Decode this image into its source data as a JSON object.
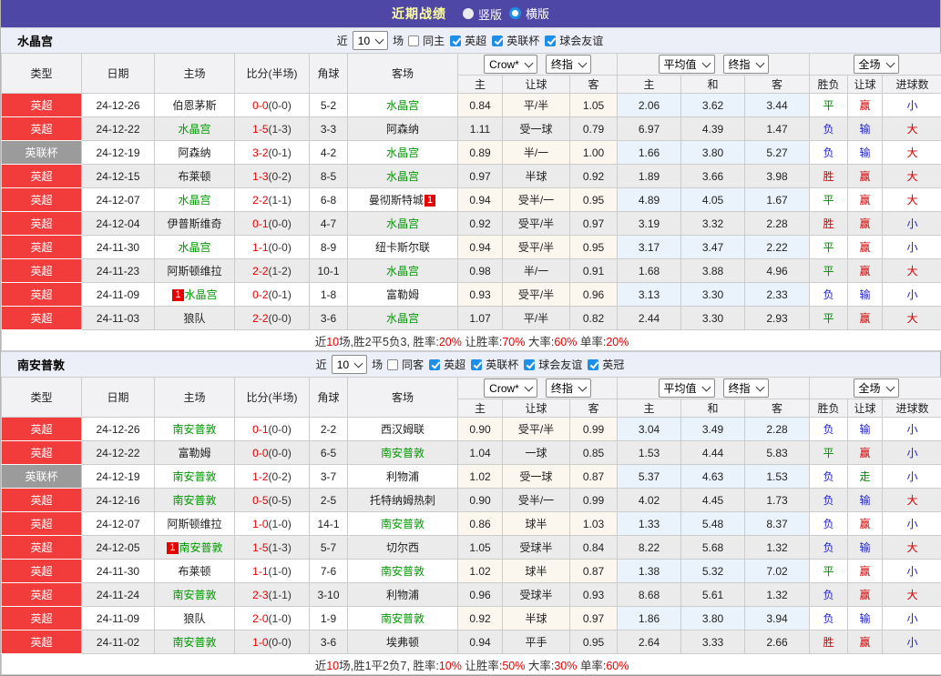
{
  "title_bar": {
    "title": "近期战绩",
    "layout_options": [
      {
        "label": "竖版",
        "selected": false
      },
      {
        "label": "横版",
        "selected": true
      }
    ]
  },
  "columns": {
    "type": "类型",
    "date": "日期",
    "home": "主场",
    "score": "比分(半场)",
    "corner": "角球",
    "away": "客场",
    "odds_home": "主",
    "odds_handicap": "让球",
    "odds_away": "客",
    "avg_home": "主",
    "avg_draw": "和",
    "avg_away": "客",
    "result": "胜负",
    "handicap_result": "让球",
    "goals": "进球数"
  },
  "odds_header": {
    "company_select": "Crow*",
    "company_time_select": "终指",
    "avg_select": "平均值",
    "avg_time_select": "终指",
    "scope_select": "全场"
  },
  "result_colors": {
    "胜": "res-red",
    "平": "res-green",
    "负": "res-blue",
    "赢": "res-red",
    "输": "res-blue",
    "走": "res-green",
    "大": "res-red",
    "小": "res-blue"
  },
  "colors": {
    "accent_purple": "#4f47a5",
    "title_yellow": "#ffff99",
    "badge_red": "#f23b3b",
    "badge_gray": "#9b9b9b",
    "focus_green": "#009900",
    "score_red": "#e60000",
    "checkbox_blue": "#1d8fe8"
  },
  "sections": [
    {
      "team": "水晶宫",
      "filter": {
        "prefix": "近",
        "count": "10",
        "suffix": "场",
        "same": {
          "label": "同主",
          "checked": false
        },
        "leagues": [
          {
            "label": "英超",
            "checked": true
          },
          {
            "label": "英联杯",
            "checked": true
          },
          {
            "label": "球会友谊",
            "checked": true
          }
        ]
      },
      "rows": [
        {
          "league": "英超",
          "lt": "red",
          "date": "24-12-26",
          "home": "伯恩茅斯",
          "home_focus": false,
          "home_card": "",
          "score": "0-0",
          "half": "(0-0)",
          "corner": "5-2",
          "away": "水晶宫",
          "away_focus": true,
          "away_card": "",
          "o1": "0.84",
          "hc": "平/半",
          "o2": "1.05",
          "a1": "2.06",
          "a2": "3.62",
          "a3": "3.44",
          "r1": "平",
          "r2": "赢",
          "r3": "小"
        },
        {
          "league": "英超",
          "lt": "red",
          "date": "24-12-22",
          "home": "水晶宫",
          "home_focus": true,
          "home_card": "",
          "score": "1-5",
          "half": "(1-3)",
          "corner": "3-3",
          "away": "阿森纳",
          "away_focus": false,
          "away_card": "",
          "o1": "1.11",
          "hc": "受一球",
          "o2": "0.79",
          "a1": "6.97",
          "a2": "4.39",
          "a3": "1.47",
          "r1": "负",
          "r2": "输",
          "r3": "大"
        },
        {
          "league": "英联杯",
          "lt": "gray",
          "date": "24-12-19",
          "home": "阿森纳",
          "home_focus": false,
          "home_card": "",
          "score": "3-2",
          "half": "(0-1)",
          "corner": "4-2",
          "away": "水晶宫",
          "away_focus": true,
          "away_card": "",
          "o1": "0.89",
          "hc": "半/一",
          "o2": "1.00",
          "a1": "1.66",
          "a2": "3.80",
          "a3": "5.27",
          "r1": "负",
          "r2": "输",
          "r3": "大"
        },
        {
          "league": "英超",
          "lt": "red",
          "date": "24-12-15",
          "home": "布莱顿",
          "home_focus": false,
          "home_card": "",
          "score": "1-3",
          "half": "(0-2)",
          "corner": "8-5",
          "away": "水晶宫",
          "away_focus": true,
          "away_card": "",
          "o1": "0.97",
          "hc": "半球",
          "o2": "0.92",
          "a1": "1.89",
          "a2": "3.66",
          "a3": "3.98",
          "r1": "胜",
          "r2": "赢",
          "r3": "大"
        },
        {
          "league": "英超",
          "lt": "red",
          "date": "24-12-07",
          "home": "水晶宫",
          "home_focus": true,
          "home_card": "",
          "score": "2-2",
          "half": "(1-1)",
          "corner": "6-8",
          "away": "曼彻斯特城",
          "away_focus": false,
          "away_card": "1",
          "o1": "0.94",
          "hc": "受半/一",
          "o2": "0.95",
          "a1": "4.89",
          "a2": "4.05",
          "a3": "1.67",
          "r1": "平",
          "r2": "赢",
          "r3": "大"
        },
        {
          "league": "英超",
          "lt": "red",
          "date": "24-12-04",
          "home": "伊普斯维奇",
          "home_focus": false,
          "home_card": "",
          "score": "0-1",
          "half": "(0-0)",
          "corner": "4-7",
          "away": "水晶宫",
          "away_focus": true,
          "away_card": "",
          "o1": "0.92",
          "hc": "受平/半",
          "o2": "0.97",
          "a1": "3.19",
          "a2": "3.32",
          "a3": "2.28",
          "r1": "胜",
          "r2": "赢",
          "r3": "小"
        },
        {
          "league": "英超",
          "lt": "red",
          "date": "24-11-30",
          "home": "水晶宫",
          "home_focus": true,
          "home_card": "",
          "score": "1-1",
          "half": "(0-0)",
          "corner": "8-9",
          "away": "纽卡斯尔联",
          "away_focus": false,
          "away_card": "",
          "o1": "0.94",
          "hc": "受平/半",
          "o2": "0.95",
          "a1": "3.17",
          "a2": "3.47",
          "a3": "2.22",
          "r1": "平",
          "r2": "赢",
          "r3": "小"
        },
        {
          "league": "英超",
          "lt": "red",
          "date": "24-11-23",
          "home": "阿斯顿维拉",
          "home_focus": false,
          "home_card": "",
          "score": "2-2",
          "half": "(1-2)",
          "corner": "10-1",
          "away": "水晶宫",
          "away_focus": true,
          "away_card": "",
          "o1": "0.98",
          "hc": "半/一",
          "o2": "0.91",
          "a1": "1.68",
          "a2": "3.88",
          "a3": "4.96",
          "r1": "平",
          "r2": "赢",
          "r3": "大"
        },
        {
          "league": "英超",
          "lt": "red",
          "date": "24-11-09",
          "home": "水晶宫",
          "home_focus": true,
          "home_card": "1",
          "score": "0-2",
          "half": "(0-1)",
          "corner": "1-8",
          "away": "富勒姆",
          "away_focus": false,
          "away_card": "",
          "o1": "0.93",
          "hc": "受平/半",
          "o2": "0.96",
          "a1": "3.13",
          "a2": "3.30",
          "a3": "2.33",
          "r1": "负",
          "r2": "输",
          "r3": "小"
        },
        {
          "league": "英超",
          "lt": "red",
          "date": "24-11-03",
          "home": "狼队",
          "home_focus": false,
          "home_card": "",
          "score": "2-2",
          "half": "(0-0)",
          "corner": "3-6",
          "away": "水晶宫",
          "away_focus": true,
          "away_card": "",
          "o1": "1.07",
          "hc": "平/半",
          "o2": "0.82",
          "a1": "2.44",
          "a2": "3.30",
          "a3": "2.93",
          "r1": "平",
          "r2": "赢",
          "r3": "大"
        }
      ],
      "summary": [
        {
          "t": "近"
        },
        {
          "t": "10",
          "red": true
        },
        {
          "t": "场,胜2平5负3, 胜率:"
        },
        {
          "t": "20%",
          "red": true
        },
        {
          "t": " 让胜率:"
        },
        {
          "t": "70%",
          "red": true
        },
        {
          "t": " 大率:"
        },
        {
          "t": "60%",
          "red": true
        },
        {
          "t": " 单率:"
        },
        {
          "t": "20%",
          "red": true
        }
      ]
    },
    {
      "team": "南安普敦",
      "filter": {
        "prefix": "近",
        "count": "10",
        "suffix": "场",
        "same": {
          "label": "同客",
          "checked": false
        },
        "leagues": [
          {
            "label": "英超",
            "checked": true
          },
          {
            "label": "英联杯",
            "checked": true
          },
          {
            "label": "球会友谊",
            "checked": true
          },
          {
            "label": "英冠",
            "checked": true
          }
        ]
      },
      "rows": [
        {
          "league": "英超",
          "lt": "red",
          "date": "24-12-26",
          "home": "南安普敦",
          "home_focus": true,
          "home_card": "",
          "score": "0-1",
          "half": "(0-0)",
          "corner": "2-2",
          "away": "西汉姆联",
          "away_focus": false,
          "away_card": "",
          "o1": "0.90",
          "hc": "受平/半",
          "o2": "0.99",
          "a1": "3.04",
          "a2": "3.49",
          "a3": "2.28",
          "r1": "负",
          "r2": "输",
          "r3": "小"
        },
        {
          "league": "英超",
          "lt": "red",
          "date": "24-12-22",
          "home": "富勒姆",
          "home_focus": false,
          "home_card": "",
          "score": "0-0",
          "half": "(0-0)",
          "corner": "6-5",
          "away": "南安普敦",
          "away_focus": true,
          "away_card": "",
          "o1": "1.04",
          "hc": "一球",
          "o2": "0.85",
          "a1": "1.53",
          "a2": "4.44",
          "a3": "5.83",
          "r1": "平",
          "r2": "赢",
          "r3": "小"
        },
        {
          "league": "英联杯",
          "lt": "gray",
          "date": "24-12-19",
          "home": "南安普敦",
          "home_focus": true,
          "home_card": "",
          "score": "1-2",
          "half": "(0-2)",
          "corner": "3-7",
          "away": "利物浦",
          "away_focus": false,
          "away_card": "",
          "o1": "1.02",
          "hc": "受一球",
          "o2": "0.87",
          "a1": "5.37",
          "a2": "4.63",
          "a3": "1.53",
          "r1": "负",
          "r2": "走",
          "r3": "小"
        },
        {
          "league": "英超",
          "lt": "red",
          "date": "24-12-16",
          "home": "南安普敦",
          "home_focus": true,
          "home_card": "",
          "score": "0-5",
          "half": "(0-5)",
          "corner": "2-5",
          "away": "托特纳姆热刺",
          "away_focus": false,
          "away_card": "",
          "o1": "0.90",
          "hc": "受半/一",
          "o2": "0.99",
          "a1": "4.02",
          "a2": "4.45",
          "a3": "1.73",
          "r1": "负",
          "r2": "输",
          "r3": "大"
        },
        {
          "league": "英超",
          "lt": "red",
          "date": "24-12-07",
          "home": "阿斯顿维拉",
          "home_focus": false,
          "home_card": "",
          "score": "1-0",
          "half": "(1-0)",
          "corner": "14-1",
          "away": "南安普敦",
          "away_focus": true,
          "away_card": "",
          "o1": "0.86",
          "hc": "球半",
          "o2": "1.03",
          "a1": "1.33",
          "a2": "5.48",
          "a3": "8.37",
          "r1": "负",
          "r2": "赢",
          "r3": "小"
        },
        {
          "league": "英超",
          "lt": "red",
          "date": "24-12-05",
          "home": "南安普敦",
          "home_focus": true,
          "home_card": "1",
          "score": "1-5",
          "half": "(1-3)",
          "corner": "5-7",
          "away": "切尔西",
          "away_focus": false,
          "away_card": "",
          "o1": "1.05",
          "hc": "受球半",
          "o2": "0.84",
          "a1": "8.22",
          "a2": "5.68",
          "a3": "1.32",
          "r1": "负",
          "r2": "输",
          "r3": "大"
        },
        {
          "league": "英超",
          "lt": "red",
          "date": "24-11-30",
          "home": "布莱顿",
          "home_focus": false,
          "home_card": "",
          "score": "1-1",
          "half": "(1-0)",
          "corner": "7-6",
          "away": "南安普敦",
          "away_focus": true,
          "away_card": "",
          "o1": "1.02",
          "hc": "球半",
          "o2": "0.87",
          "a1": "1.38",
          "a2": "5.32",
          "a3": "7.02",
          "r1": "平",
          "r2": "赢",
          "r3": "小"
        },
        {
          "league": "英超",
          "lt": "red",
          "date": "24-11-24",
          "home": "南安普敦",
          "home_focus": true,
          "home_card": "",
          "score": "2-3",
          "half": "(1-1)",
          "corner": "3-10",
          "away": "利物浦",
          "away_focus": false,
          "away_card": "",
          "o1": "0.96",
          "hc": "受球半",
          "o2": "0.93",
          "a1": "8.68",
          "a2": "5.61",
          "a3": "1.32",
          "r1": "负",
          "r2": "赢",
          "r3": "大"
        },
        {
          "league": "英超",
          "lt": "red",
          "date": "24-11-09",
          "home": "狼队",
          "home_focus": false,
          "home_card": "",
          "score": "2-0",
          "half": "(1-0)",
          "corner": "1-9",
          "away": "南安普敦",
          "away_focus": true,
          "away_card": "",
          "o1": "0.92",
          "hc": "半球",
          "o2": "0.97",
          "a1": "1.86",
          "a2": "3.80",
          "a3": "3.94",
          "r1": "负",
          "r2": "输",
          "r3": "小"
        },
        {
          "league": "英超",
          "lt": "red",
          "date": "24-11-02",
          "home": "南安普敦",
          "home_focus": true,
          "home_card": "",
          "score": "1-0",
          "half": "(0-0)",
          "corner": "3-6",
          "away": "埃弗顿",
          "away_focus": false,
          "away_card": "",
          "o1": "0.94",
          "hc": "平手",
          "o2": "0.95",
          "a1": "2.64",
          "a2": "3.33",
          "a3": "2.66",
          "r1": "胜",
          "r2": "赢",
          "r3": "小"
        }
      ],
      "summary": [
        {
          "t": "近"
        },
        {
          "t": "10",
          "red": true
        },
        {
          "t": "场,胜1平2负7, 胜率:"
        },
        {
          "t": "10%",
          "red": true
        },
        {
          "t": " 让胜率:"
        },
        {
          "t": "50%",
          "red": true
        },
        {
          "t": " 大率:"
        },
        {
          "t": "30%",
          "red": true
        },
        {
          "t": " 单率:"
        },
        {
          "t": "60%",
          "red": true
        }
      ]
    }
  ]
}
